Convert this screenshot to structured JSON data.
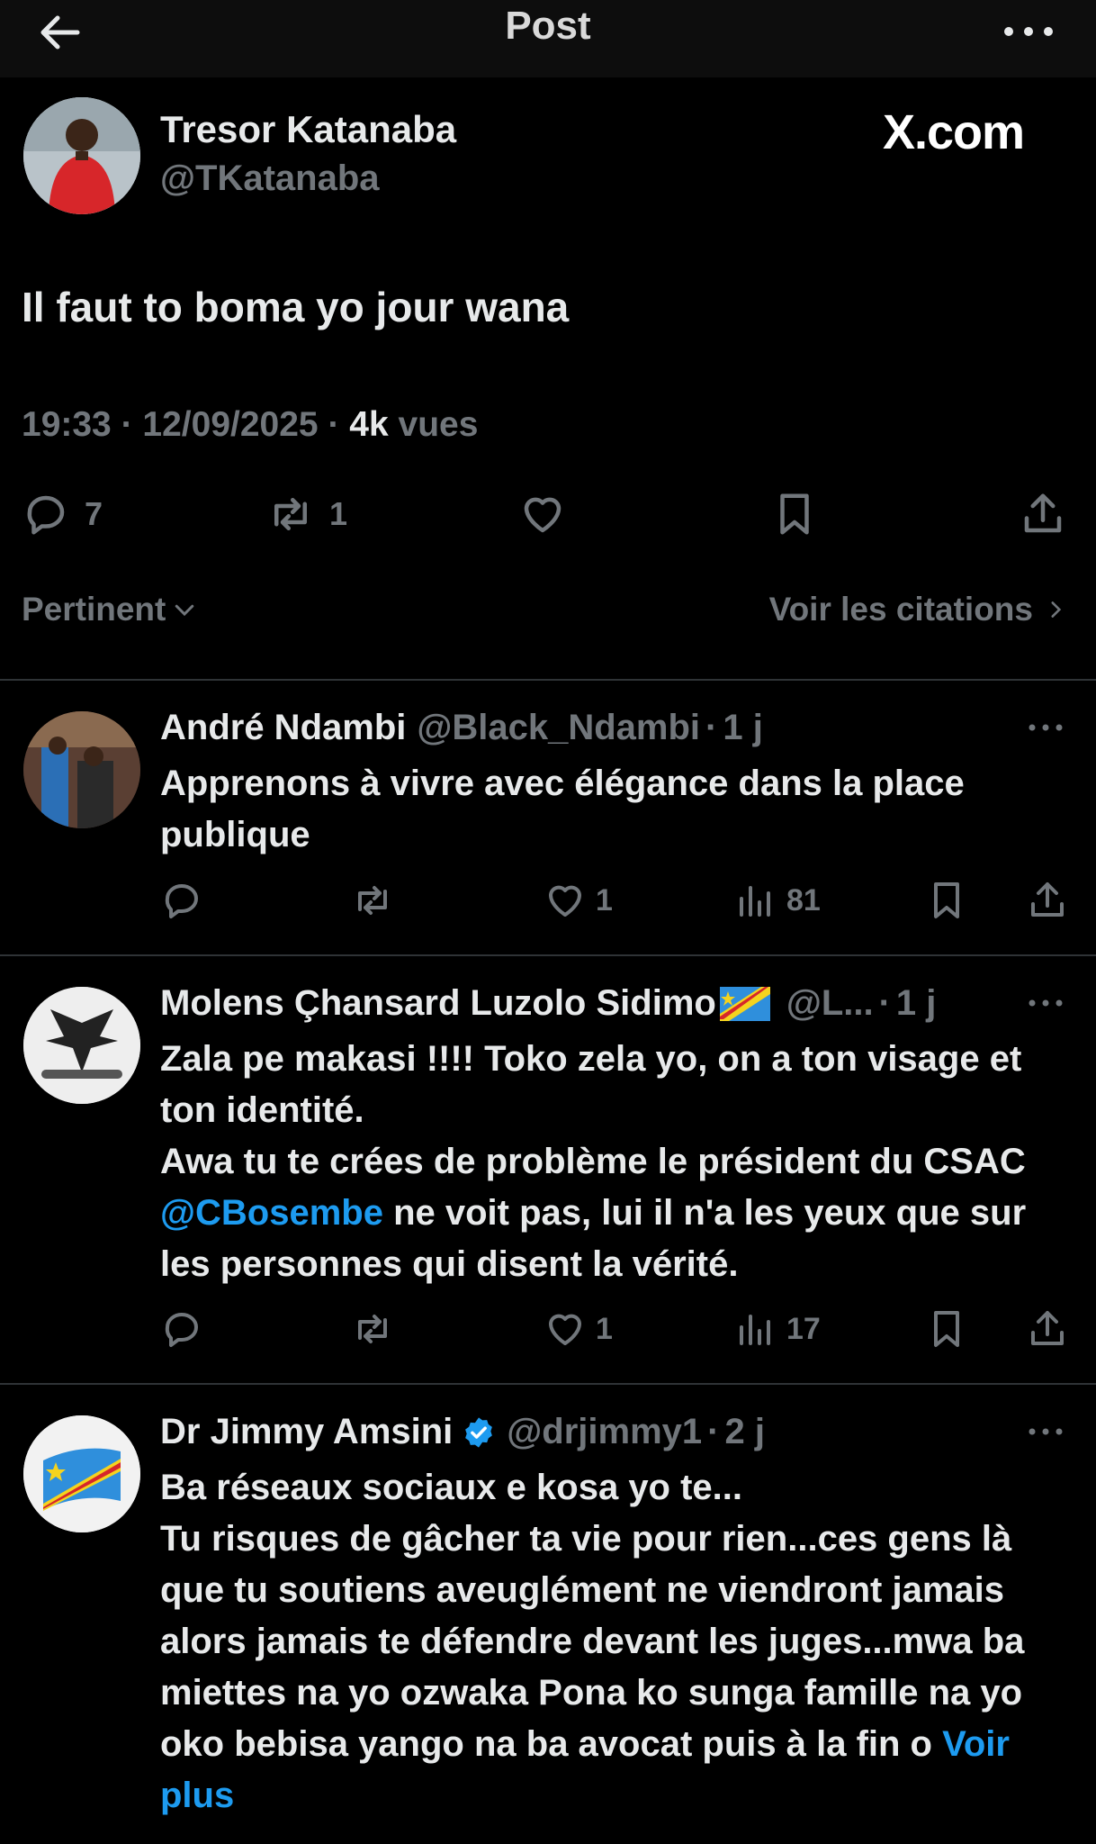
{
  "topbar": {
    "title": "Post"
  },
  "watermark": "X.com",
  "post": {
    "author_name": "Tresor Katanaba",
    "author_handle": "@TKatanaba",
    "text": "Il faut to boma yo jour wana",
    "time": "19:33",
    "date": "12/09/2025",
    "views": "4k",
    "views_label": "vues",
    "replies": "7",
    "reposts": "1"
  },
  "sort": {
    "left": "Pertinent",
    "right": "Voir les citations"
  },
  "replies": [
    {
      "name": "André Ndambi",
      "handle": "@Black_Ndambi",
      "age": "1 j",
      "text": "Apprenons à vivre avec élégance dans la place publique",
      "likes": "1",
      "views": "81"
    },
    {
      "name": "Molens Çhansard Luzolo Sidimo",
      "handle": "@L...",
      "age": "1 j",
      "text_line1": "Zala pe makasi !!!! Toko zela yo, on a ton visage et ton identité.",
      "text_line2a": "Awa tu te crées de problème le président du CSAC ",
      "mention": "@CBosembe",
      "text_line2b": " ne voit pas, lui il n'a les yeux que sur les personnes qui disent la vérité.",
      "likes": "1",
      "views": "17"
    },
    {
      "name": "Dr Jimmy Amsini",
      "handle": "@drjimmy1",
      "age": "2 j",
      "text_line1": "Ba réseaux sociaux e kosa yo te...",
      "text_line2": "Tu risques de gâcher ta vie pour rien...ces gens là que tu soutiens aveuglément ne viendront jamais alors jamais te défendre devant les juges...mwa ba miettes na yo ozwaka Pona ko sunga famille na yo oko bebisa yango na ba avocat puis à la fin o ",
      "see_more": "Voir plus"
    }
  ],
  "colors": {
    "background": "#000000",
    "muted": "#71767b",
    "link": "#1d9bf0",
    "divider": "#2f3336"
  }
}
